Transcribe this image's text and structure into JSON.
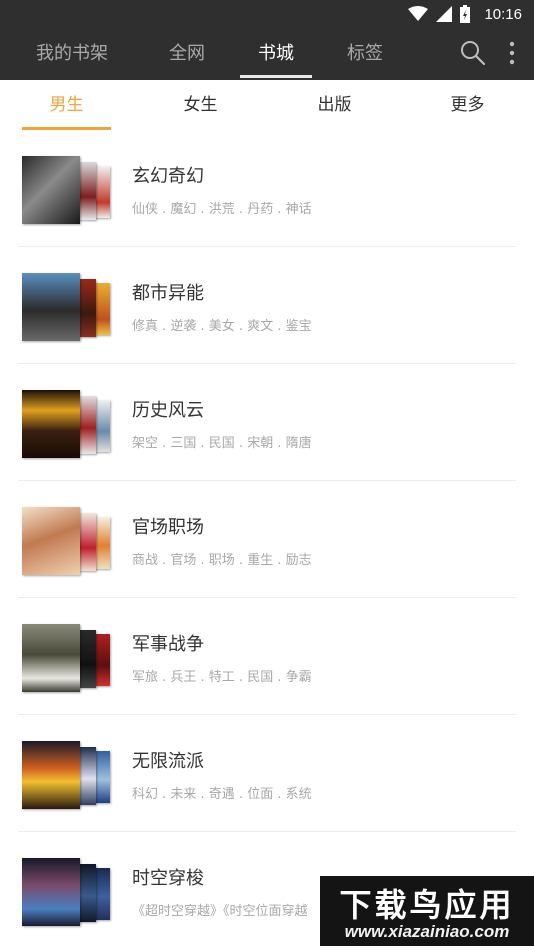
{
  "status_bar": {
    "time": "10:16",
    "icons": [
      "wifi-icon",
      "signal-icon",
      "battery-icon"
    ]
  },
  "app_tabs": [
    {
      "label": "我的书架",
      "active": false
    },
    {
      "label": "全网",
      "active": false
    },
    {
      "label": "书城",
      "active": true
    },
    {
      "label": "标签",
      "active": false
    }
  ],
  "actions": {
    "icons": [
      "search-icon",
      "more-vert-icon"
    ]
  },
  "sub_tabs": [
    {
      "label": "男生",
      "active": true
    },
    {
      "label": "女生",
      "active": false
    },
    {
      "label": "出版",
      "active": false
    },
    {
      "label": "更多",
      "active": false
    }
  ],
  "colors": {
    "app_bar": "#2f2f2f",
    "accent": "#f0a43a",
    "tag_text": "#a8a8a8"
  },
  "categories": [
    {
      "title": "玄幻奇幻",
      "tags": "仙侠 . 魔幻 . 洪荒 . 丹药 . 神话"
    },
    {
      "title": "都市异能",
      "tags": "修真 . 逆袭 . 美女 . 爽文 . 鉴宝"
    },
    {
      "title": "历史风云",
      "tags": "架空 . 三国 . 民国 . 宋朝 . 隋唐"
    },
    {
      "title": "官场职场",
      "tags": "商战 . 官场 . 职场 . 重生 . 励志"
    },
    {
      "title": "军事战争",
      "tags": "军旅 . 兵王 . 特工 . 民国 . 争霸"
    },
    {
      "title": "无限流派",
      "tags": "科幻 . 未来 . 奇遇 . 位面 . 系统"
    },
    {
      "title": "时空穿梭",
      "tags": "《超时空穿越》《时空位面穿越"
    }
  ],
  "watermark": {
    "title": "下载鸟应用",
    "url": "www.xiazainiao.com"
  }
}
